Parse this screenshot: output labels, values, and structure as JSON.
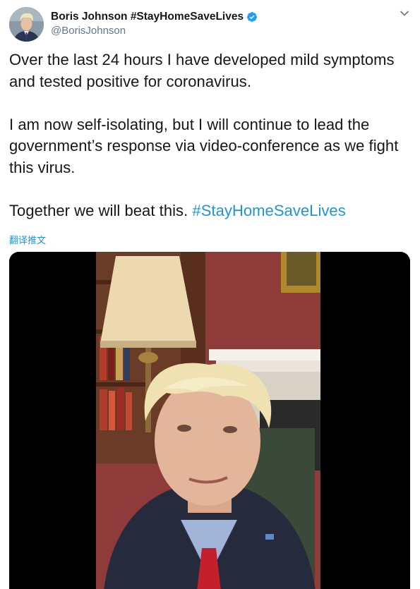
{
  "author": {
    "display_name": "Boris Johnson #StayHomeSaveLives",
    "handle": "@BorisJohnson",
    "avatar_icon": "profile-photo",
    "verified_icon": "verified-badge-icon",
    "verified_color": "#1da1f2"
  },
  "menu": {
    "icon": "chevron-down-icon"
  },
  "tweet": {
    "paragraph_1": "Over the last 24 hours I have developed mild symptoms and tested positive for coronavirus.",
    "paragraph_2": "I am now self-isolating, but I will continue to lead the government’s response via video-conference as we fight this virus.",
    "paragraph_3_text": "Together we will beat this. ",
    "paragraph_3_hashtag": "#StayHomeSaveLives"
  },
  "translate_label": "翻译推文",
  "media": {
    "type": "video",
    "background": "#000000"
  },
  "colors": {
    "link": "#1b95e0",
    "text": "#14171a",
    "secondary_text": "#657786"
  }
}
